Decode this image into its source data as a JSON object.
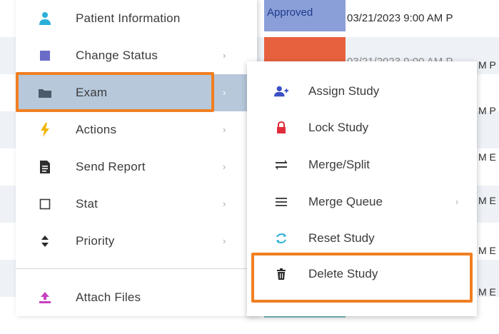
{
  "colors": {
    "highlight": "#f07f22",
    "active_row": "#b7c8db",
    "status_approved": "#8a9fd8",
    "status_orange": "#e8613f",
    "status_teal": "#79c6c3",
    "icon_purple": "#7b4cc4",
    "icon_blue": "#3a4fc4",
    "icon_red": "#e02c3a",
    "icon_magenta": "#c640c0",
    "icon_gold": "#f0b400",
    "icon_cyan": "#2ab0d8"
  },
  "worklist": {
    "status_label": "Approved",
    "date_text": "03/21/2023 9:00 AM P",
    "date_partial": "03/21/2023 9:00 AM P",
    "edge_texts": [
      "M P",
      "M E",
      "M E",
      "M E",
      "M E",
      "M E"
    ]
  },
  "main_menu": {
    "items": [
      {
        "label": "Patient Information",
        "icon": "person-icon",
        "has_arrow": false
      },
      {
        "label": "Change Status",
        "icon": "square-icon",
        "has_arrow": true
      },
      {
        "label": "Exam",
        "icon": "folder-icon",
        "has_arrow": true,
        "active": true
      },
      {
        "label": "Actions",
        "icon": "lightning-icon",
        "has_arrow": true
      },
      {
        "label": "Send Report",
        "icon": "report-icon",
        "has_arrow": true
      },
      {
        "label": "Stat",
        "icon": "checkbox-icon",
        "has_arrow": true
      },
      {
        "label": "Priority",
        "icon": "sort-icon",
        "has_arrow": true
      },
      {
        "label": "Attach Files",
        "icon": "upload-icon",
        "has_arrow": false
      }
    ],
    "arrow_glyph": "›"
  },
  "sub_menu": {
    "items": [
      {
        "label": "Assign Study",
        "icon": "assign-user-icon"
      },
      {
        "label": "Lock Study",
        "icon": "lock-icon"
      },
      {
        "label": "Merge/Split",
        "icon": "merge-split-icon"
      },
      {
        "label": "Merge Queue",
        "icon": "list-icon",
        "has_arrow": true
      },
      {
        "label": "Reset Study",
        "icon": "reset-icon"
      },
      {
        "label": "Delete Study",
        "icon": "trash-icon"
      }
    ],
    "arrow_glyph": "›"
  }
}
